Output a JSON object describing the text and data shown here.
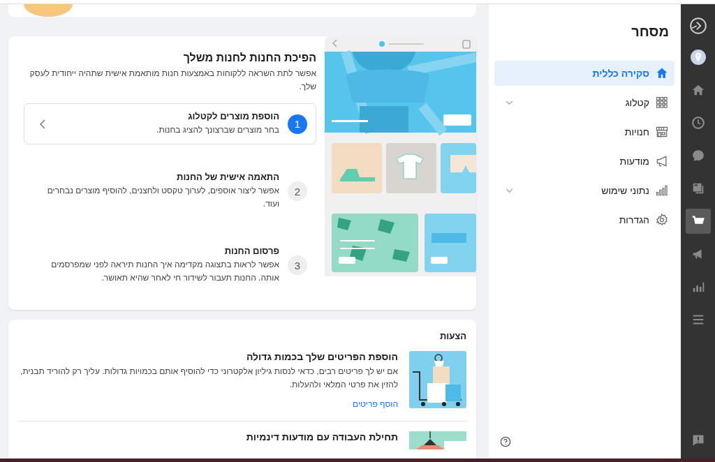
{
  "rail": {
    "items": [
      {
        "kind": "location",
        "selected": false
      },
      {
        "kind": "home",
        "selected": false
      },
      {
        "kind": "clock",
        "selected": false
      },
      {
        "kind": "chat",
        "selected": false
      },
      {
        "kind": "pages",
        "selected": false
      },
      {
        "kind": "cart",
        "selected": true
      },
      {
        "kind": "megaphone",
        "selected": false
      },
      {
        "kind": "chart",
        "selected": false
      },
      {
        "kind": "menu",
        "selected": false
      }
    ]
  },
  "sidebar": {
    "title": "מסחר",
    "items": [
      {
        "label": "סקירה כללית",
        "kind": "home",
        "selected": true,
        "expandable": false
      },
      {
        "label": "קטלוג",
        "kind": "grid",
        "selected": false,
        "expandable": true
      },
      {
        "label": "חנויות",
        "kind": "store",
        "selected": false,
        "expandable": false
      },
      {
        "label": "מודעות",
        "kind": "megaphone",
        "selected": false,
        "expandable": false
      },
      {
        "label": "נתוני שימוש",
        "kind": "chart",
        "selected": false,
        "expandable": true
      },
      {
        "label": "הגדרות",
        "kind": "gear",
        "selected": false,
        "expandable": false
      }
    ]
  },
  "setup": {
    "title": "הפיכת החנות לחנות משלך",
    "description": "אפשר לתת השראה ללקוחות באמצעות חנות מותאמת אישית שתהיה ייחודית לעסק שלך.",
    "steps": [
      {
        "number": "1",
        "title": "הוספת מוצרים לקטלוג",
        "description": "בחר מוצרים שברצונך להציג בחנות.",
        "selected": true
      },
      {
        "number": "2",
        "title": "התאמה אישית של החנות",
        "description": "אפשר ליצור אוספים, לערוך טקסט ולחצנים, להוסיף מוצרים נבחרים ועוד.",
        "selected": false
      },
      {
        "number": "3",
        "title": "פרסום החנות",
        "description": "אפשר לראות בתצוגה מקדימה איך החנות תיראה לפני שמפרסמים אותה. החנות תעבור לשידור חי לאחר שהיא תאושר.",
        "selected": false
      }
    ]
  },
  "suggestions": {
    "title": "הצעות",
    "items": [
      {
        "kind": "bags",
        "title": "הוספת הפריטים שלך בכמות גדולה",
        "description": "אם יש לך פריטים רבים, כדאי לנסות גיליון אלקטרוני כדי להוסיף אותם בכמויות גדולות. עליך רק להוריד תבנית, להזין את פרטי המלאי ולהעלות.",
        "link": "הוסף פריטים"
      },
      {
        "kind": "lamp",
        "title": "תחילת העבודה עם מודעות דינמיות"
      }
    ]
  }
}
